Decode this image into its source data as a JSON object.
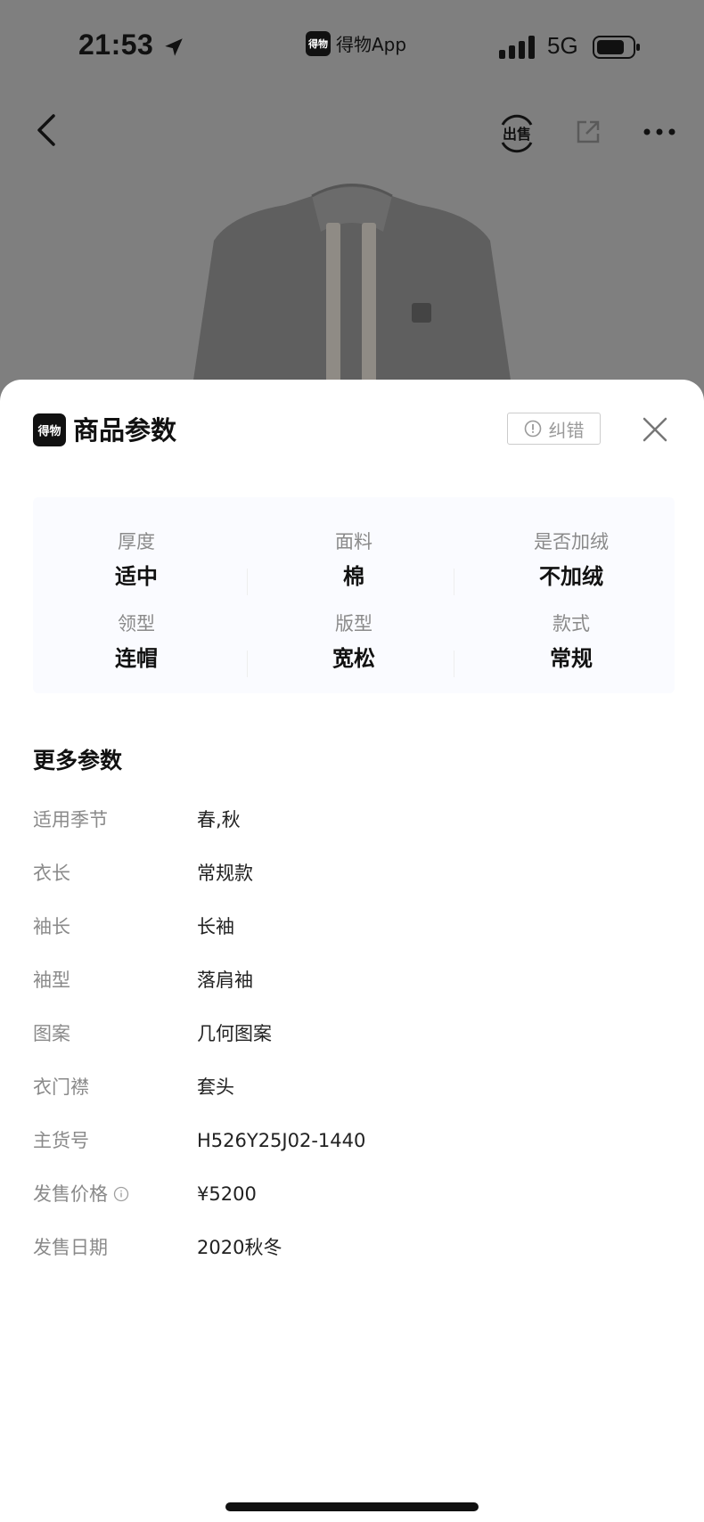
{
  "status_bar": {
    "time": "21:53",
    "app_name": "得物App",
    "app_logo": "得物",
    "network": "5G"
  },
  "nav": {
    "sell_label": "出售"
  },
  "sheet": {
    "logo": "得物",
    "title": "商品参数",
    "report_label": "纠错",
    "key_params": [
      {
        "label": "厚度",
        "value": "适中"
      },
      {
        "label": "面料",
        "value": "棉"
      },
      {
        "label": "是否加绒",
        "value": "不加绒"
      },
      {
        "label": "领型",
        "value": "连帽"
      },
      {
        "label": "版型",
        "value": "宽松"
      },
      {
        "label": "款式",
        "value": "常规"
      }
    ],
    "more_title": "更多参数",
    "more_params": [
      {
        "label": "适用季节",
        "value": "春,秋"
      },
      {
        "label": "衣长",
        "value": "常规款"
      },
      {
        "label": "袖长",
        "value": "长袖"
      },
      {
        "label": "袖型",
        "value": "落肩袖"
      },
      {
        "label": "图案",
        "value": "几何图案"
      },
      {
        "label": "衣门襟",
        "value": "套头"
      },
      {
        "label": "主货号",
        "value": "H526Y25J02-1440"
      },
      {
        "label": "发售价格",
        "value": "¥5200",
        "info_icon": "info-circle-icon"
      },
      {
        "label": "发售日期",
        "value": "2020秋冬"
      }
    ]
  },
  "icons": {
    "back": "chevron-left-icon",
    "sell": "sell-icon",
    "share": "share-icon",
    "more": "more-dots-icon",
    "close": "close-icon",
    "report": "alert-circle-icon",
    "location": "location-arrow-icon",
    "signal": "cellular-signal-icon",
    "battery": "battery-icon"
  }
}
